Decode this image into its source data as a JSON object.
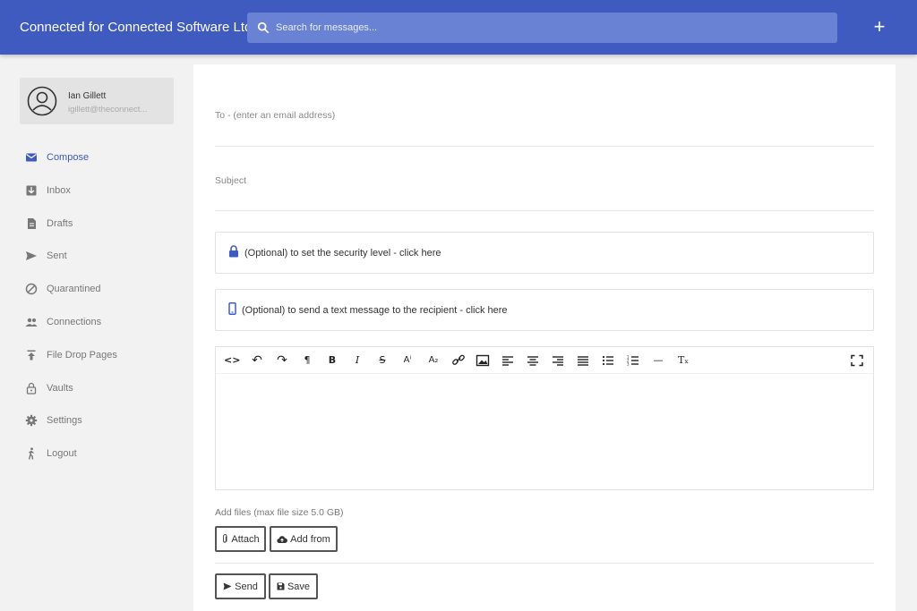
{
  "app": {
    "title": "Connected for Connected Software Ltd"
  },
  "search": {
    "placeholder": "Search for messages...",
    "icon": "search-icon"
  },
  "header": {
    "add_label": "+"
  },
  "user": {
    "name": "Ian Gillett",
    "email": "igillett@theconnect..."
  },
  "sidebar": {
    "items": [
      {
        "label": "Compose",
        "icon": "envelope-icon",
        "active": true
      },
      {
        "label": "Inbox",
        "icon": "inbox-icon"
      },
      {
        "label": "Drafts",
        "icon": "document-icon"
      },
      {
        "label": "Sent",
        "icon": "send-icon"
      },
      {
        "label": "Quarantined",
        "icon": "block-icon"
      },
      {
        "label": "Connections",
        "icon": "people-icon"
      },
      {
        "label": "File Drop Pages",
        "icon": "upload-icon"
      },
      {
        "label": "Vaults",
        "icon": "lock-icon"
      },
      {
        "label": "Settings",
        "icon": "gear-icon"
      },
      {
        "label": "Logout",
        "icon": "walking-person-icon"
      }
    ]
  },
  "compose": {
    "to_placeholder": "To - (enter an email address)",
    "subject_placeholder": "Subject",
    "security_text": "(Optional) to set the security level - click here",
    "sms_text": "(Optional) to send a text message to the recipient - click here",
    "files_label": "Add files (max file size 5.0 GB)",
    "attach_label": "Attach",
    "add_from_label": "Add from",
    "send_label": "Send",
    "save_label": "Save"
  },
  "toolbar": {
    "code": "<>",
    "undo": "↶",
    "redo": "↷",
    "paragraph": "¶",
    "bold": "B",
    "italic": "I",
    "strike": "S",
    "superscript": "Aⁱ",
    "subscript": "A₂",
    "hr": "—",
    "clear_format": "Tₓ"
  },
  "colors": {
    "primary": "#3f5bbf",
    "search_bg": "#6a82d3",
    "sidebar_bg": "#f2f2f2"
  }
}
